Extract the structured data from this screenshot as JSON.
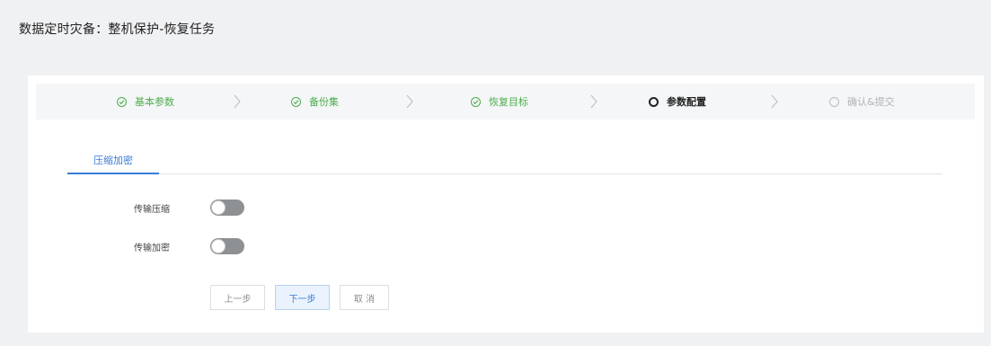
{
  "page": {
    "title": "数据定时灾备：整机保护-恢复任务"
  },
  "steps": [
    {
      "label": "基本参数",
      "status": "done"
    },
    {
      "label": "备份集",
      "status": "done"
    },
    {
      "label": "恢复目标",
      "status": "done"
    },
    {
      "label": "参数配置",
      "status": "active"
    },
    {
      "label": "确认&提交",
      "status": "todo"
    }
  ],
  "tabs": {
    "compress_encrypt": "压缩加密"
  },
  "form": {
    "transfer_compress": {
      "label": "传输压缩",
      "enabled": false
    },
    "transfer_encrypt": {
      "label": "传输加密",
      "enabled": false
    }
  },
  "buttons": {
    "prev": "上一步",
    "next": "下一步",
    "cancel": "取 消"
  },
  "colors": {
    "done": "#4cae4c",
    "active": "#222222",
    "todo": "#b0b4b8",
    "accent": "#3a7bd5"
  },
  "icons": {
    "done": "check-circle-icon",
    "active": "circle-icon",
    "todo": "circle-icon",
    "separator": "chevron-right-icon"
  }
}
